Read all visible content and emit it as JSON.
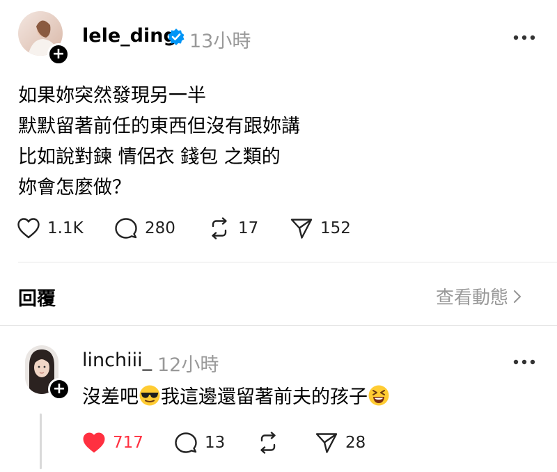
{
  "post": {
    "username": "lele_ding",
    "verified": true,
    "time": "13小時",
    "more_icon": "more-dots-icon",
    "lines": [
      "如果妳突然發現另一半",
      "默默留著前任的東西但沒有跟妳講",
      "比如說對鍊 情侶衣 錢包 之類的",
      "妳會怎麼做？"
    ],
    "actions": {
      "likes": "1.1K",
      "comments": "280",
      "reposts": "17",
      "shares": "152"
    }
  },
  "replies_section": {
    "title": "回覆",
    "activity_link": "查看動態"
  },
  "reply": {
    "username": "linchiii_",
    "time": "12小時",
    "text_before": "沒差吧",
    "text_middle": "我這邊還留著前夫的孩子",
    "emoji_1": "sunglasses-face-emoji",
    "emoji_2": "grinning-squinting-face-emoji",
    "actions": {
      "likes": "717",
      "comments": "13",
      "shares": "28"
    },
    "like_color": "#ff3040"
  },
  "colors": {
    "text": "#000000",
    "muted": "#999999",
    "verified": "#0095f6",
    "divider": "#e6e6e6"
  }
}
